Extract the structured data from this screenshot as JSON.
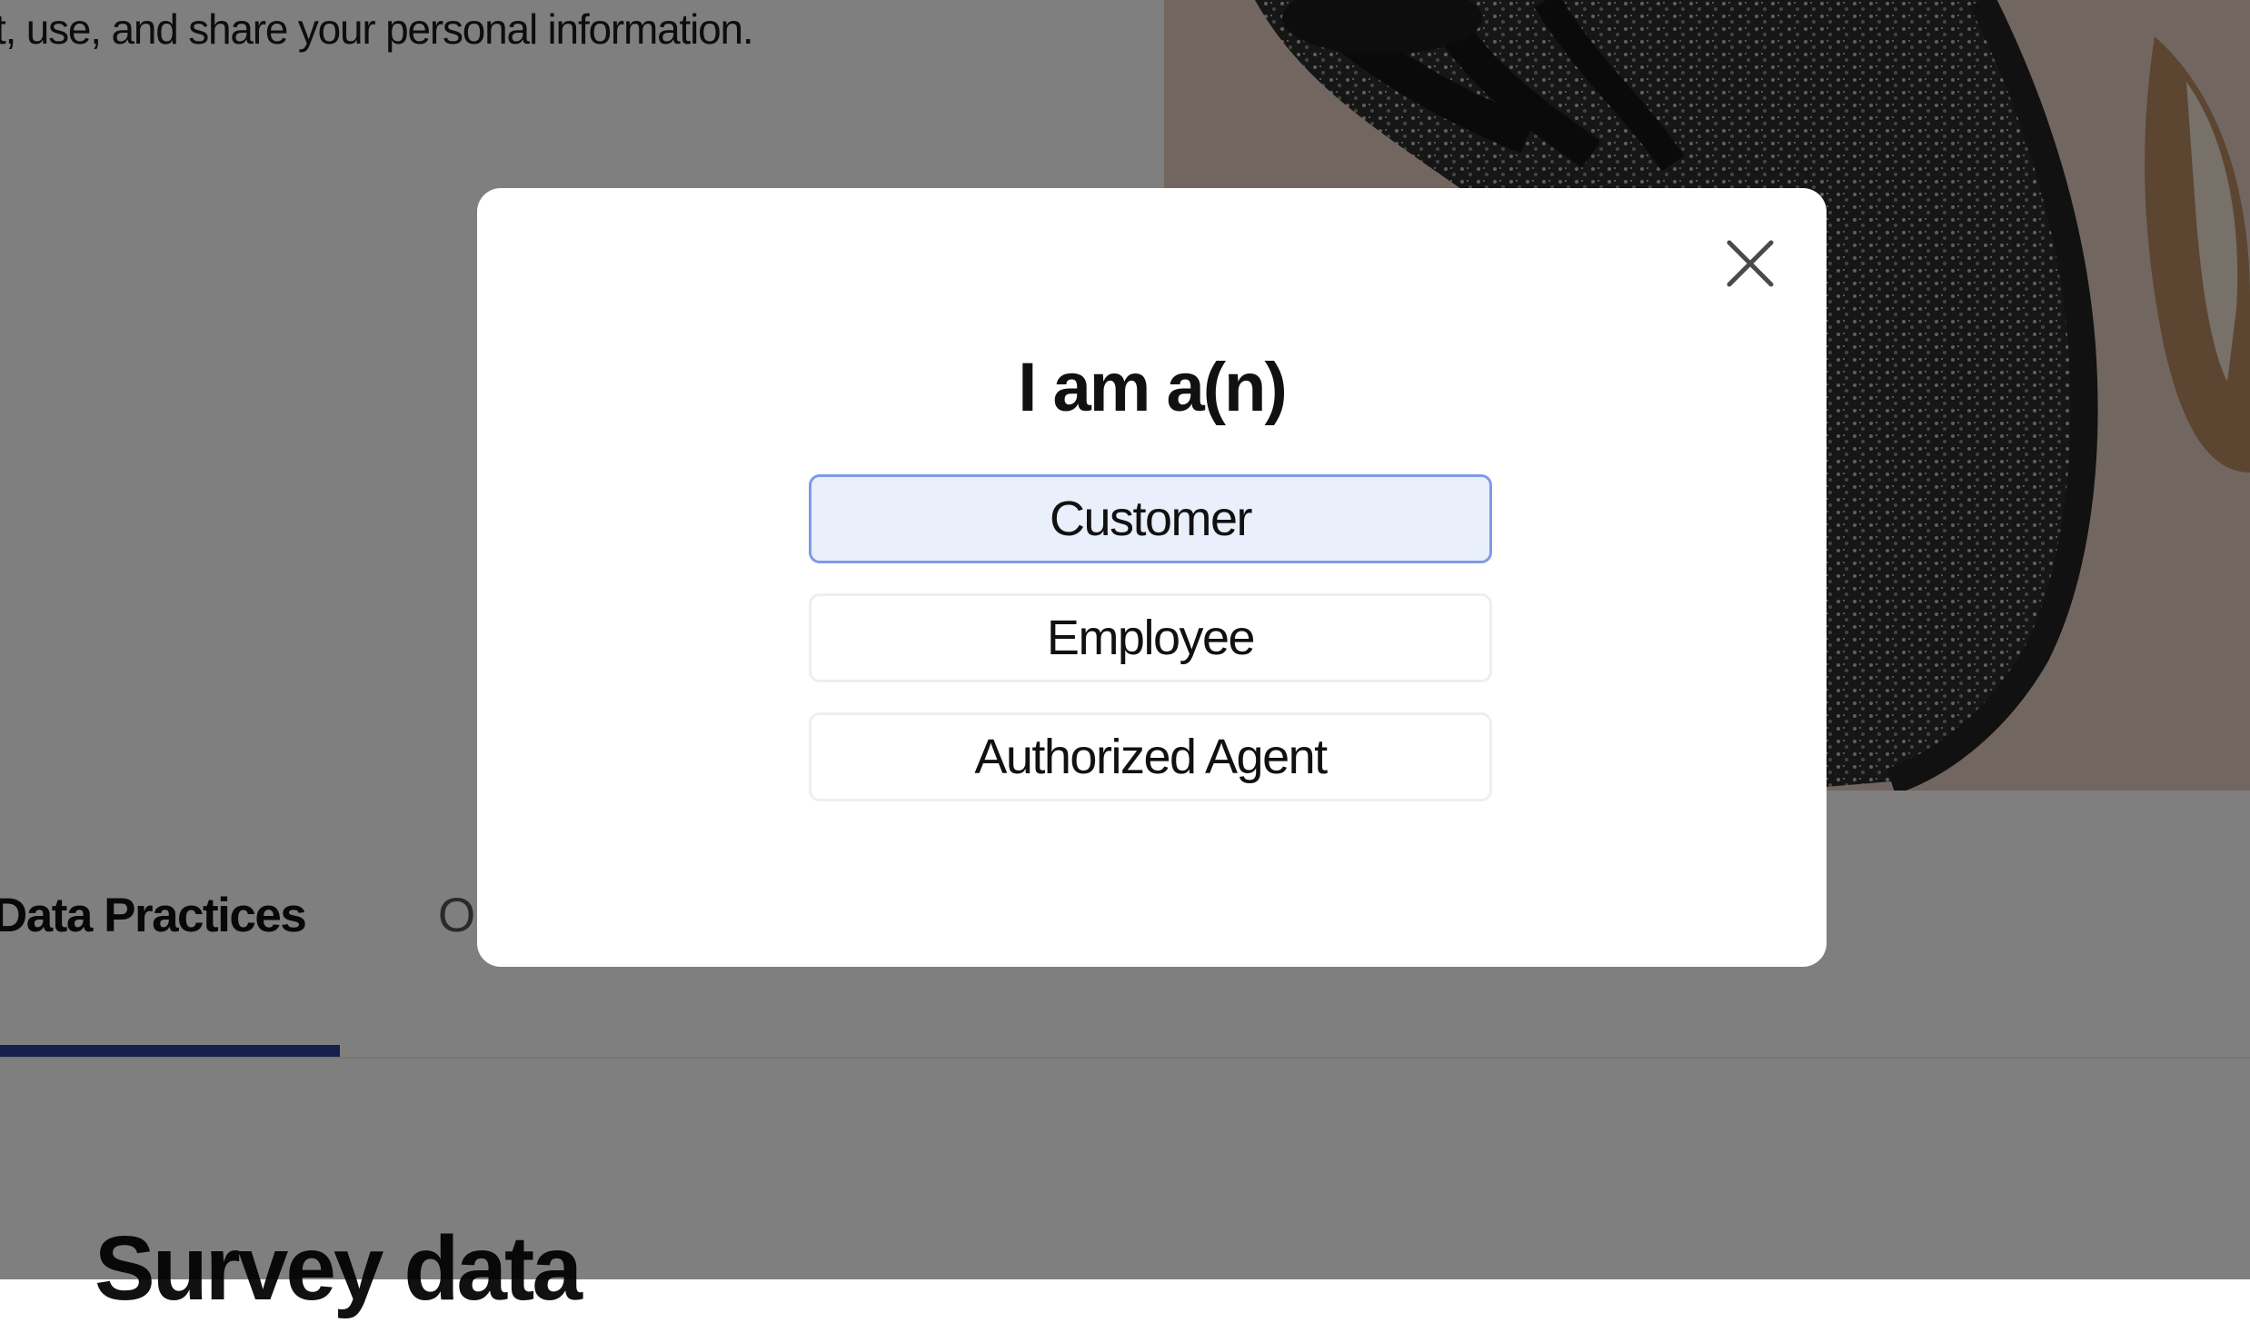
{
  "background_page": {
    "intro_text": "t, use, and share your personal information.",
    "tabs": [
      {
        "label": "Data Practices",
        "active": true
      },
      {
        "label": "O",
        "active": false
      }
    ],
    "section_heading": "Survey data",
    "accent_color": "#2a3f94"
  },
  "modal": {
    "title": "I am a(n)",
    "close_icon": "close-icon",
    "options": [
      {
        "label": "Customer",
        "selected": true
      },
      {
        "label": "Employee",
        "selected": false
      },
      {
        "label": "Authorized Agent",
        "selected": false
      }
    ],
    "selected_fill": "#e9effb",
    "selected_border": "#7f9be3"
  },
  "overlay_color": "#000000"
}
